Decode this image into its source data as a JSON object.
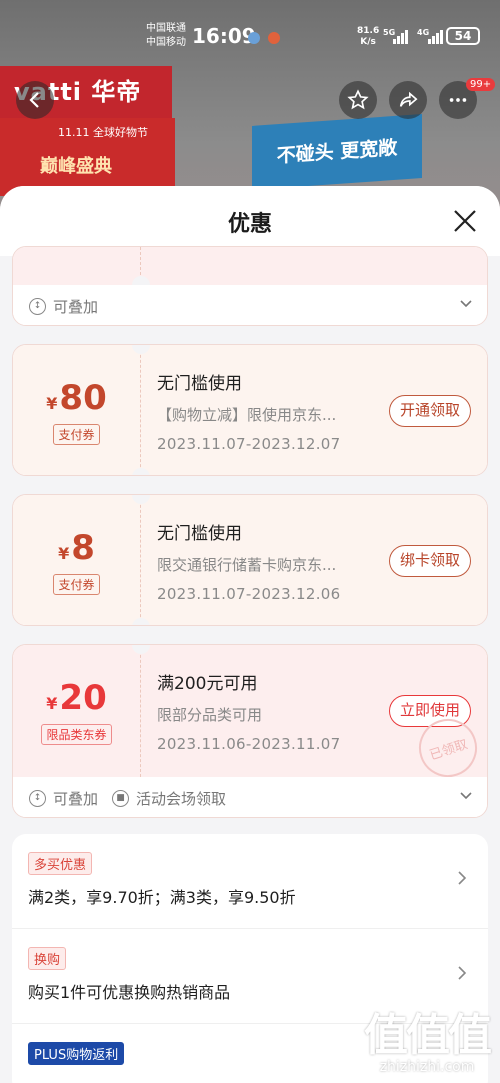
{
  "status_bar": {
    "carrier_1": "中国联通",
    "carrier_2": "中国移动",
    "time": "16:09",
    "net_speed": "81.6",
    "net_unit": "K/s",
    "sig1": "5G",
    "sig2": "4G",
    "battery": "54"
  },
  "product_header": {
    "brand_text": "vatti 华帝",
    "promo_small": "11.11 全球好物节",
    "promo_big": "巅峰盛典",
    "store_sign": "不碰头 更宽敞",
    "badge": "99+"
  },
  "sheet": {
    "title": "优惠"
  },
  "stack_rows": {
    "top_stackable": "可叠加",
    "bottom_stackable": "可叠加",
    "bottom_venue": "活动会场领取"
  },
  "coupons": [
    {
      "currency": "¥",
      "amount": "80",
      "tag": "支付券",
      "condition": "无门槛使用",
      "desc": "【购物立减】限使用京东...",
      "date": "2023.11.07-2023.12.07",
      "button": "开通领取"
    },
    {
      "currency": "¥",
      "amount": "8",
      "tag": "支付券",
      "condition": "无门槛使用",
      "desc": "限交通银行储蓄卡购京东...",
      "date": "2023.11.07-2023.12.06",
      "button": "绑卡领取"
    },
    {
      "currency": "¥",
      "amount": "20",
      "tag": "限品类东券",
      "condition": "满200元可用",
      "desc": "限部分品类可用",
      "date": "2023.11.06-2023.11.07",
      "button": "立即使用",
      "stamp": "已领取"
    }
  ],
  "offers": [
    {
      "tag": "多买优惠",
      "text": "满2类，享9.70折；满3类，享9.50折"
    },
    {
      "tag": "换购",
      "text": "购买1件可优惠换购热销商品"
    },
    {
      "tag": "PLUS购物返利",
      "text": ""
    }
  ],
  "watermark": {
    "big": "值值值",
    "small": "zhizhizhi.com"
  },
  "colors": {
    "accent_brown": "#c3472c",
    "accent_red": "#e8383a",
    "plus_blue": "#1d4aa8",
    "sheet_bg": "#f4f4f6"
  }
}
